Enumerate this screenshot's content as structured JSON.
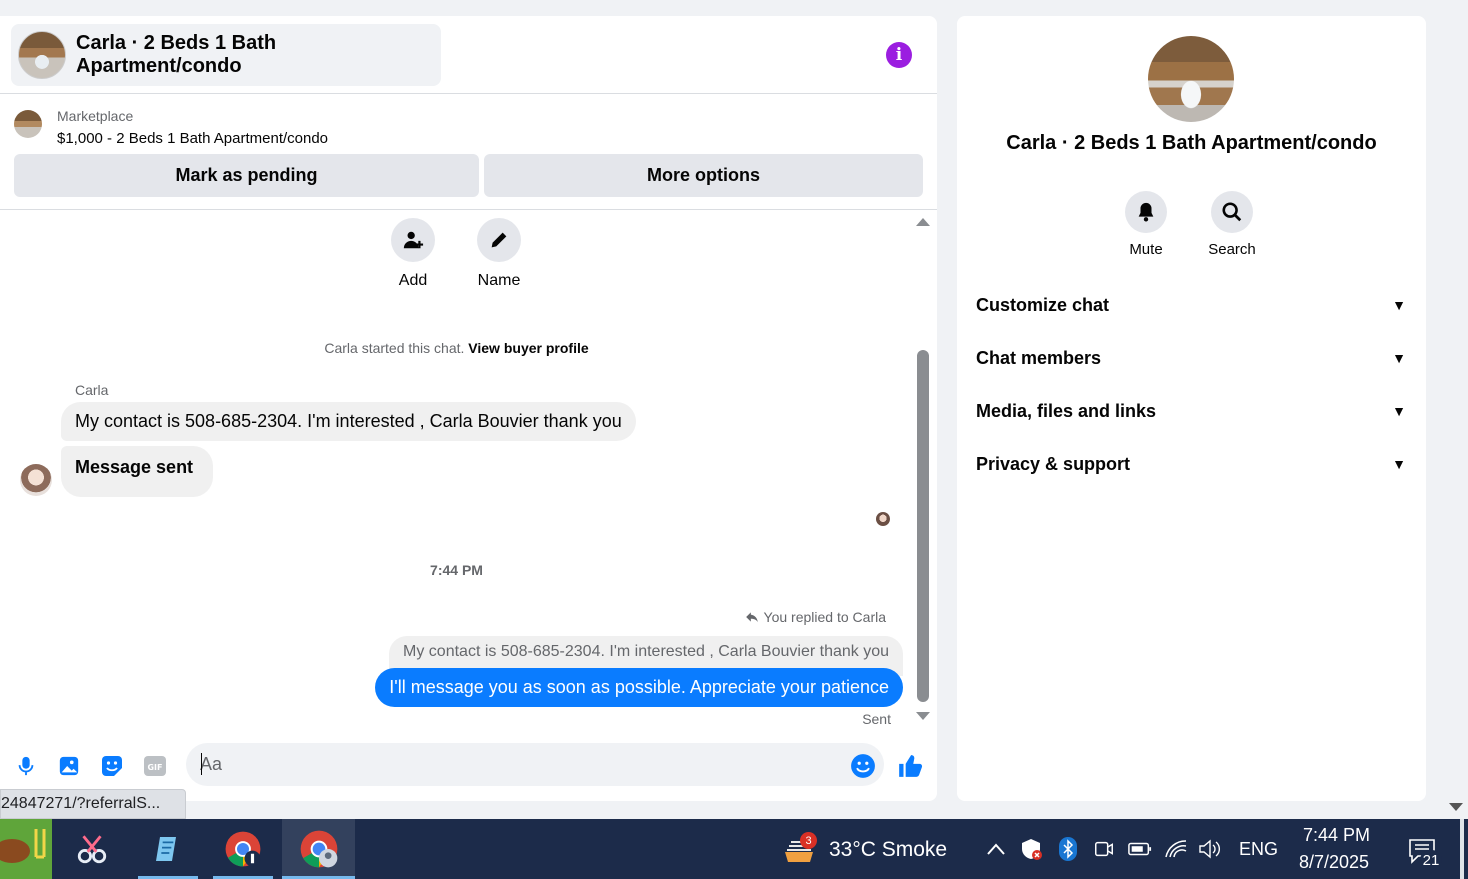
{
  "header": {
    "title": "Carla · 2 Beds 1 Bath Apartment/condo",
    "info_icon": "i"
  },
  "listing": {
    "label": "Marketplace",
    "title": "$1,000 - 2 Beds 1 Bath Apartment/condo",
    "mark_pending_label": "Mark as pending",
    "more_options_label": "More options"
  },
  "quick_actions": [
    {
      "label": "Add",
      "icon": "add-person-icon"
    },
    {
      "label": "Name",
      "icon": "pencil-icon"
    }
  ],
  "conversation": {
    "started_text": "Carla started this chat.",
    "view_buyer_profile": "View buyer profile",
    "sender_name": "Carla",
    "messages_in": [
      "My contact is  508-685-2304. I'm interested ,  Carla Bouvier thank you",
      "Message sent"
    ],
    "timestamp": "7:44 PM",
    "replied_to": "You replied to Carla",
    "quoted_message": "My contact is  508-685-2304. I'm interested ,  Carla Bouvier thank you",
    "message_out": "I'll message you as soon as possible. Appreciate your patience",
    "status": "Sent"
  },
  "composer": {
    "placeholder": "Aa"
  },
  "url_tooltip": "24847271/?referralS...",
  "info_panel": {
    "name": "Carla · 2 Beds 1 Bath Apartment/condo",
    "actions": [
      {
        "label": "Mute",
        "icon": "bell-icon"
      },
      {
        "label": "Search",
        "icon": "search-icon"
      }
    ],
    "sections": [
      "Customize chat",
      "Chat members",
      "Media, files and links",
      "Privacy & support"
    ]
  },
  "taskbar": {
    "weather_badge": "3",
    "weather": "33°C  Smoke",
    "language": "ENG",
    "time": "7:44 PM",
    "date": "8/7/2025",
    "notification_count": "21"
  },
  "colors": {
    "accent": "#0a7cff",
    "info": "#9b1ee0",
    "taskbar": "#1c2b4a"
  }
}
